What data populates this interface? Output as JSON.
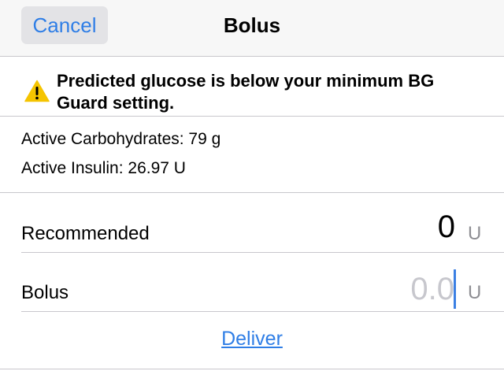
{
  "navbar": {
    "cancel_label": "Cancel",
    "title": "Bolus"
  },
  "warning": {
    "icon": "warning-triangle-icon",
    "icon_color": "#f5c400",
    "line1": "Predicted glucose is below your minimum BG",
    "line2": "Guard setting."
  },
  "info": {
    "carbs": "Active Carbohydrates: 79 g",
    "insulin": "Active Insulin: 26.97 U"
  },
  "recommended": {
    "label": "Recommended",
    "value": "0",
    "unit": "U"
  },
  "bolus": {
    "label": "Bolus",
    "placeholder": "0.0",
    "value": "",
    "unit": "U"
  },
  "actions": {
    "deliver_label": "Deliver"
  },
  "colors": {
    "accent": "#2f7ee6",
    "separator": "#c8c7cc",
    "placeholder": "#c7c7cd",
    "unit": "#8e8e93"
  }
}
